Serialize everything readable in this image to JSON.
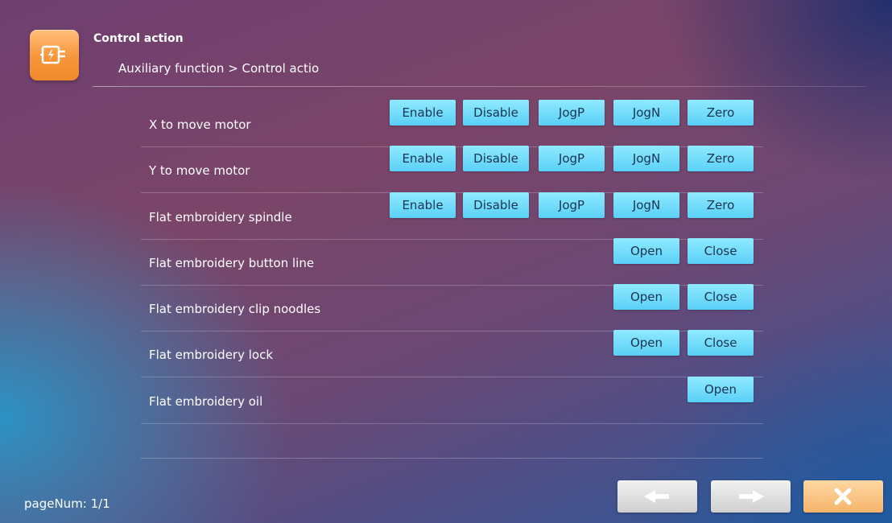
{
  "header": {
    "icon": "control-motor-icon",
    "title": "Control action",
    "breadcrumb": "Auxiliary function > Control actio"
  },
  "rows": [
    {
      "label": "X to move motor",
      "buttons": [
        "Enable",
        "Disable",
        "JogP",
        "JogN",
        "Zero"
      ]
    },
    {
      "label": "Y to move motor",
      "buttons": [
        "Enable",
        "Disable",
        "JogP",
        "JogN",
        "Zero"
      ]
    },
    {
      "label": "Flat embroidery spindle",
      "buttons": [
        "Enable",
        "Disable",
        "JogP",
        "JogN",
        "Zero"
      ]
    },
    {
      "label": "Flat embroidery button line",
      "buttons": [
        "Open",
        "Close"
      ]
    },
    {
      "label": "Flat embroidery clip noodles",
      "buttons": [
        "Open",
        "Close"
      ]
    },
    {
      "label": "Flat embroidery lock",
      "buttons": [
        "Open",
        "Close"
      ]
    },
    {
      "label": "Flat embroidery oil",
      "buttons": [
        "Open"
      ]
    }
  ],
  "footer": {
    "page_num": "pageNum: 1/1",
    "prev_icon": "arrow-left-icon",
    "next_icon": "arrow-right-icon",
    "close_icon": "close-x-icon"
  },
  "colors": {
    "button_bg": "#6fdcfb",
    "button_text": "#1b3350",
    "header_icon_bg": "#f7953a",
    "close_button_bg": "#f5b46a",
    "nav_button_bg": "#e0e0e0"
  }
}
